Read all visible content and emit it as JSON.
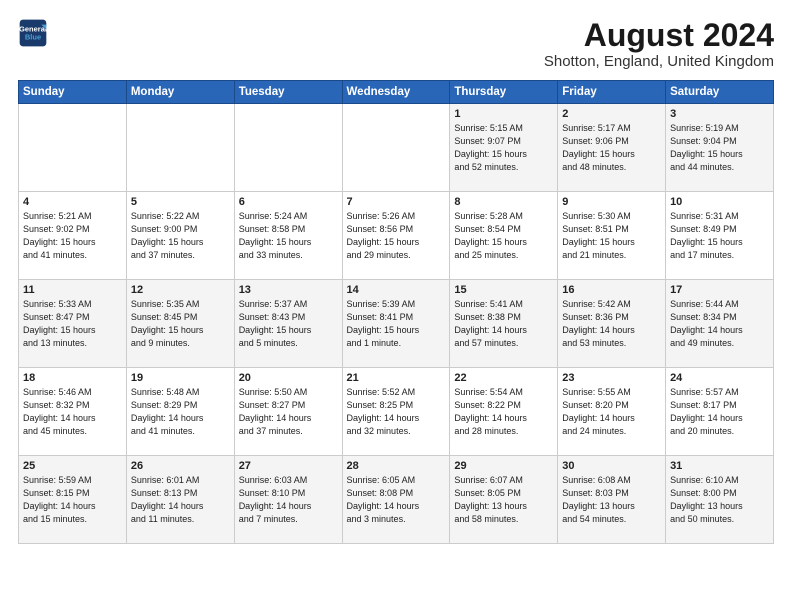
{
  "header": {
    "logo_line1": "General",
    "logo_line2": "Blue",
    "main_title": "August 2024",
    "subtitle": "Shotton, England, United Kingdom"
  },
  "columns": [
    "Sunday",
    "Monday",
    "Tuesday",
    "Wednesday",
    "Thursday",
    "Friday",
    "Saturday"
  ],
  "weeks": [
    [
      {
        "day": "",
        "info": ""
      },
      {
        "day": "",
        "info": ""
      },
      {
        "day": "",
        "info": ""
      },
      {
        "day": "",
        "info": ""
      },
      {
        "day": "1",
        "info": "Sunrise: 5:15 AM\nSunset: 9:07 PM\nDaylight: 15 hours\nand 52 minutes."
      },
      {
        "day": "2",
        "info": "Sunrise: 5:17 AM\nSunset: 9:06 PM\nDaylight: 15 hours\nand 48 minutes."
      },
      {
        "day": "3",
        "info": "Sunrise: 5:19 AM\nSunset: 9:04 PM\nDaylight: 15 hours\nand 44 minutes."
      }
    ],
    [
      {
        "day": "4",
        "info": "Sunrise: 5:21 AM\nSunset: 9:02 PM\nDaylight: 15 hours\nand 41 minutes."
      },
      {
        "day": "5",
        "info": "Sunrise: 5:22 AM\nSunset: 9:00 PM\nDaylight: 15 hours\nand 37 minutes."
      },
      {
        "day": "6",
        "info": "Sunrise: 5:24 AM\nSunset: 8:58 PM\nDaylight: 15 hours\nand 33 minutes."
      },
      {
        "day": "7",
        "info": "Sunrise: 5:26 AM\nSunset: 8:56 PM\nDaylight: 15 hours\nand 29 minutes."
      },
      {
        "day": "8",
        "info": "Sunrise: 5:28 AM\nSunset: 8:54 PM\nDaylight: 15 hours\nand 25 minutes."
      },
      {
        "day": "9",
        "info": "Sunrise: 5:30 AM\nSunset: 8:51 PM\nDaylight: 15 hours\nand 21 minutes."
      },
      {
        "day": "10",
        "info": "Sunrise: 5:31 AM\nSunset: 8:49 PM\nDaylight: 15 hours\nand 17 minutes."
      }
    ],
    [
      {
        "day": "11",
        "info": "Sunrise: 5:33 AM\nSunset: 8:47 PM\nDaylight: 15 hours\nand 13 minutes."
      },
      {
        "day": "12",
        "info": "Sunrise: 5:35 AM\nSunset: 8:45 PM\nDaylight: 15 hours\nand 9 minutes."
      },
      {
        "day": "13",
        "info": "Sunrise: 5:37 AM\nSunset: 8:43 PM\nDaylight: 15 hours\nand 5 minutes."
      },
      {
        "day": "14",
        "info": "Sunrise: 5:39 AM\nSunset: 8:41 PM\nDaylight: 15 hours\nand 1 minute."
      },
      {
        "day": "15",
        "info": "Sunrise: 5:41 AM\nSunset: 8:38 PM\nDaylight: 14 hours\nand 57 minutes."
      },
      {
        "day": "16",
        "info": "Sunrise: 5:42 AM\nSunset: 8:36 PM\nDaylight: 14 hours\nand 53 minutes."
      },
      {
        "day": "17",
        "info": "Sunrise: 5:44 AM\nSunset: 8:34 PM\nDaylight: 14 hours\nand 49 minutes."
      }
    ],
    [
      {
        "day": "18",
        "info": "Sunrise: 5:46 AM\nSunset: 8:32 PM\nDaylight: 14 hours\nand 45 minutes."
      },
      {
        "day": "19",
        "info": "Sunrise: 5:48 AM\nSunset: 8:29 PM\nDaylight: 14 hours\nand 41 minutes."
      },
      {
        "day": "20",
        "info": "Sunrise: 5:50 AM\nSunset: 8:27 PM\nDaylight: 14 hours\nand 37 minutes."
      },
      {
        "day": "21",
        "info": "Sunrise: 5:52 AM\nSunset: 8:25 PM\nDaylight: 14 hours\nand 32 minutes."
      },
      {
        "day": "22",
        "info": "Sunrise: 5:54 AM\nSunset: 8:22 PM\nDaylight: 14 hours\nand 28 minutes."
      },
      {
        "day": "23",
        "info": "Sunrise: 5:55 AM\nSunset: 8:20 PM\nDaylight: 14 hours\nand 24 minutes."
      },
      {
        "day": "24",
        "info": "Sunrise: 5:57 AM\nSunset: 8:17 PM\nDaylight: 14 hours\nand 20 minutes."
      }
    ],
    [
      {
        "day": "25",
        "info": "Sunrise: 5:59 AM\nSunset: 8:15 PM\nDaylight: 14 hours\nand 15 minutes."
      },
      {
        "day": "26",
        "info": "Sunrise: 6:01 AM\nSunset: 8:13 PM\nDaylight: 14 hours\nand 11 minutes."
      },
      {
        "day": "27",
        "info": "Sunrise: 6:03 AM\nSunset: 8:10 PM\nDaylight: 14 hours\nand 7 minutes."
      },
      {
        "day": "28",
        "info": "Sunrise: 6:05 AM\nSunset: 8:08 PM\nDaylight: 14 hours\nand 3 minutes."
      },
      {
        "day": "29",
        "info": "Sunrise: 6:07 AM\nSunset: 8:05 PM\nDaylight: 13 hours\nand 58 minutes."
      },
      {
        "day": "30",
        "info": "Sunrise: 6:08 AM\nSunset: 8:03 PM\nDaylight: 13 hours\nand 54 minutes."
      },
      {
        "day": "31",
        "info": "Sunrise: 6:10 AM\nSunset: 8:00 PM\nDaylight: 13 hours\nand 50 minutes."
      }
    ]
  ]
}
